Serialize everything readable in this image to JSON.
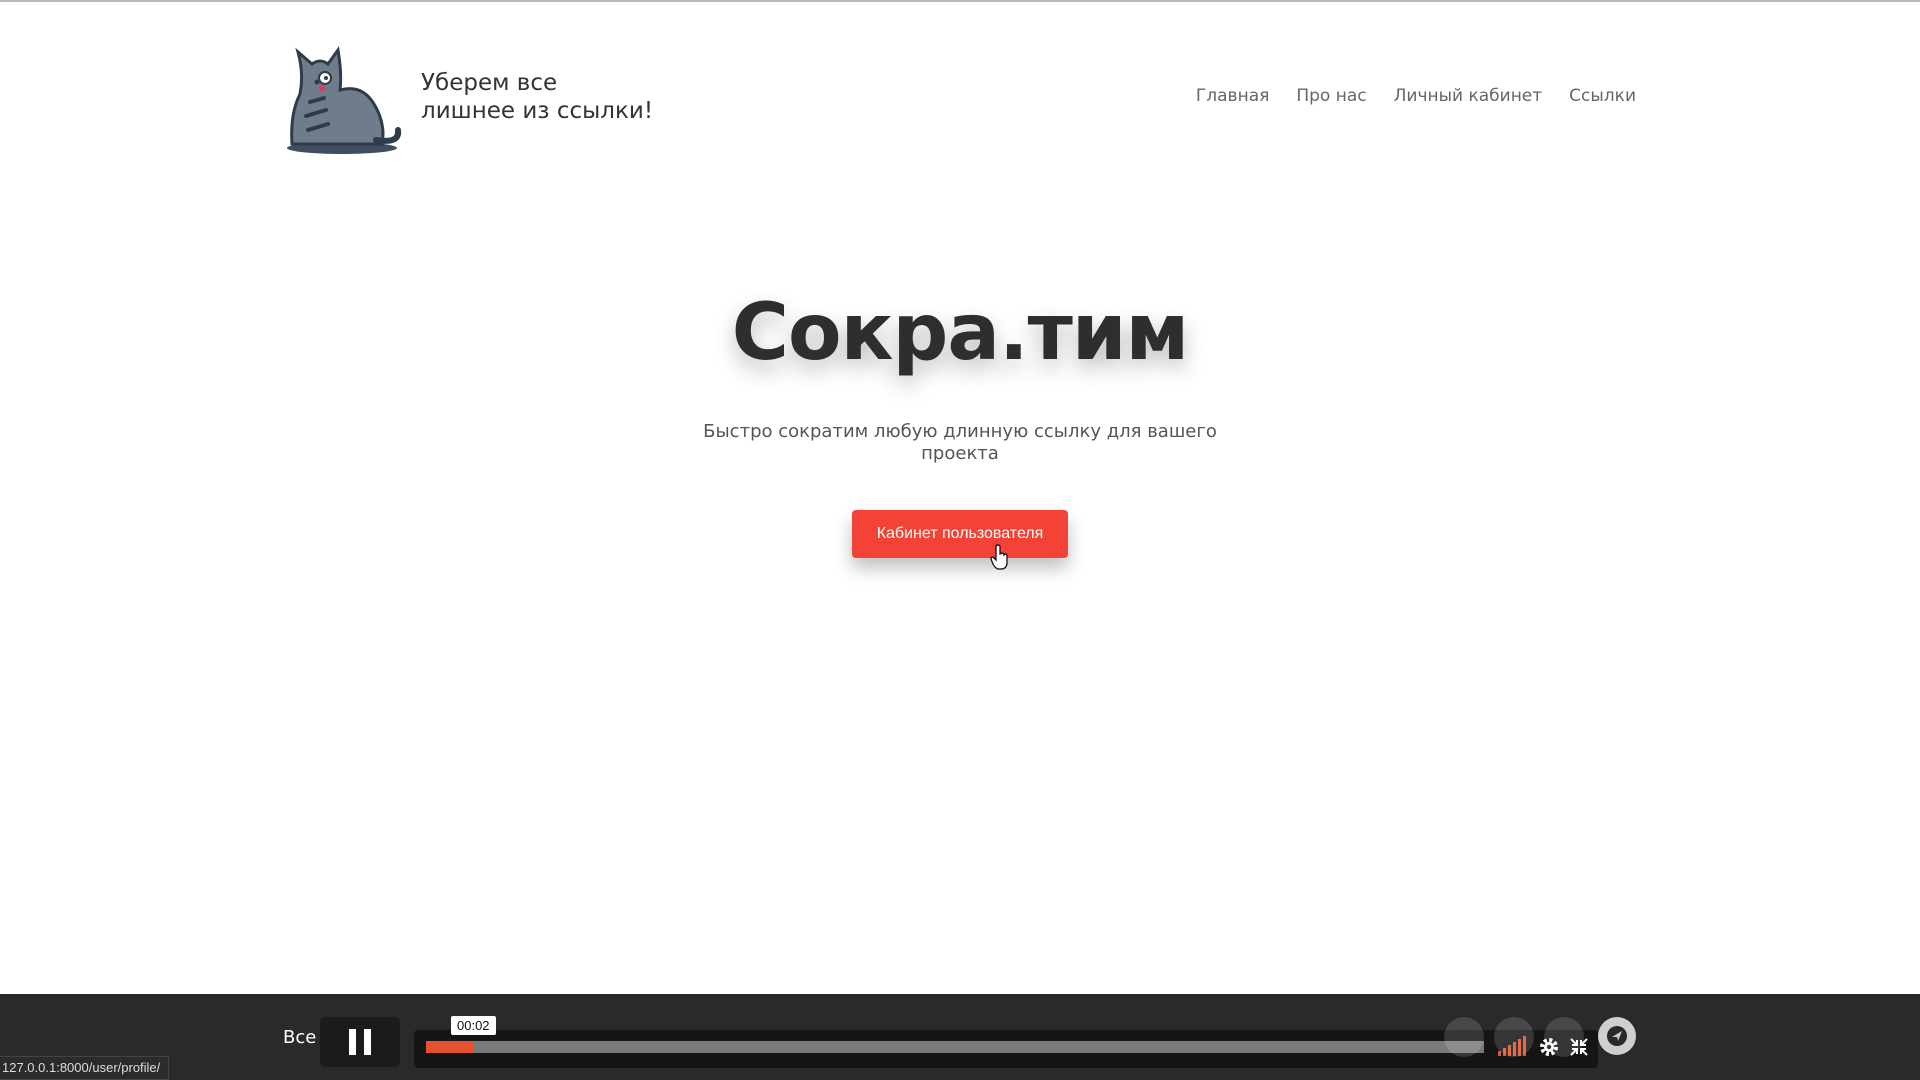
{
  "header": {
    "tagline_line1": "Уберем все",
    "tagline_line2": "лишнее из ссылки!",
    "nav": [
      {
        "label": "Главная"
      },
      {
        "label": "Про нас"
      },
      {
        "label": "Личный кабинет"
      },
      {
        "label": "Ссылки"
      }
    ]
  },
  "hero": {
    "title": "Сокра.тим",
    "subtitle": "Быстро сократим любую длинную ссылку для вашего проекта",
    "cta_label": "Кабинет пользователя"
  },
  "footer": {
    "text": "Все"
  },
  "player": {
    "current_time": "00:02",
    "progress": 0.045
  },
  "status_bar": {
    "url": "127.0.0.1:8000/user/profile/"
  },
  "colors": {
    "accent": "#f44336",
    "progress": "#e4522f"
  },
  "icons": [
    "cat-logo-icon",
    "cursor-hand-icon",
    "pause-icon",
    "volume-icon",
    "gear-icon",
    "fullscreen-icon",
    "share-icon"
  ]
}
